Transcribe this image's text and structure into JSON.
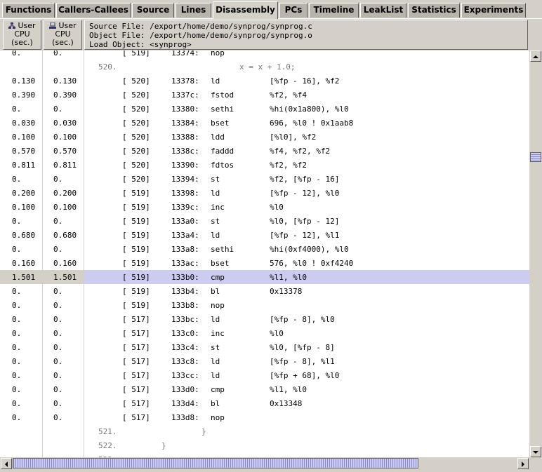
{
  "tabs": [
    {
      "label": "Functions",
      "active": false
    },
    {
      "label": "Callers-Callees",
      "active": false
    },
    {
      "label": "Source",
      "active": false
    },
    {
      "label": "Lines",
      "active": false
    },
    {
      "label": "Disassembly",
      "active": true
    },
    {
      "label": "PCs",
      "active": false
    },
    {
      "label": "Timeline",
      "active": false
    },
    {
      "label": "LeakList",
      "active": false
    },
    {
      "label": "Statistics",
      "active": false
    },
    {
      "label": "Experiments",
      "active": false
    }
  ],
  "header": {
    "col1": {
      "line1": "User",
      "line2": "CPU",
      "line3": "(sec.)"
    },
    "col2": {
      "line1": "User",
      "line2": "CPU",
      "line3": "(sec.)"
    },
    "source_file": "Source File: /export/home/demo/synprog/synprog.c",
    "object_file": "Object File: /export/home/demo/synprog/synprog.o",
    "load_object": "Load Object: <synprog>"
  },
  "rows": [
    {
      "kind": "asm",
      "c1": "0.",
      "c2": "0.",
      "line": "[ 519]",
      "addr": "13374:",
      "op": "nop",
      "args": ""
    },
    {
      "kind": "src",
      "num": "520.",
      "code": "x = x + 1.0;"
    },
    {
      "kind": "asm",
      "c1": "0.130",
      "c2": "0.130",
      "line": "[ 520]",
      "addr": "13378:",
      "op": "ld",
      "args": "[%fp - 16], %f2"
    },
    {
      "kind": "asm",
      "c1": "0.390",
      "c2": "0.390",
      "line": "[ 520]",
      "addr": "1337c:",
      "op": "fstod",
      "args": "%f2, %f4"
    },
    {
      "kind": "asm",
      "c1": "0.",
      "c2": "0.",
      "line": "[ 520]",
      "addr": "13380:",
      "op": "sethi",
      "args": "%hi(0x1a800), %l0"
    },
    {
      "kind": "asm",
      "c1": "0.030",
      "c2": "0.030",
      "line": "[ 520]",
      "addr": "13384:",
      "op": "bset",
      "args": "696, %l0 ! 0x1aab8"
    },
    {
      "kind": "asm",
      "c1": "0.100",
      "c2": "0.100",
      "line": "[ 520]",
      "addr": "13388:",
      "op": "ldd",
      "args": "[%l0], %f2"
    },
    {
      "kind": "asm",
      "c1": "0.570",
      "c2": "0.570",
      "line": "[ 520]",
      "addr": "1338c:",
      "op": "faddd",
      "args": "%f4, %f2, %f2"
    },
    {
      "kind": "asm",
      "c1": "0.811",
      "c2": "0.811",
      "line": "[ 520]",
      "addr": "13390:",
      "op": "fdtos",
      "args": "%f2, %f2"
    },
    {
      "kind": "asm",
      "c1": "0.",
      "c2": "0.",
      "line": "[ 520]",
      "addr": "13394:",
      "op": "st",
      "args": "%f2, [%fp - 16]"
    },
    {
      "kind": "asm",
      "c1": "0.200",
      "c2": "0.200",
      "line": "[ 519]",
      "addr": "13398:",
      "op": "ld",
      "args": "[%fp - 12], %l0"
    },
    {
      "kind": "asm",
      "c1": "0.100",
      "c2": "0.100",
      "line": "[ 519]",
      "addr": "1339c:",
      "op": "inc",
      "args": "%l0"
    },
    {
      "kind": "asm",
      "c1": "0.",
      "c2": "0.",
      "line": "[ 519]",
      "addr": "133a0:",
      "op": "st",
      "args": "%l0, [%fp - 12]"
    },
    {
      "kind": "asm",
      "c1": "0.680",
      "c2": "0.680",
      "line": "[ 519]",
      "addr": "133a4:",
      "op": "ld",
      "args": "[%fp - 12], %l1"
    },
    {
      "kind": "asm",
      "c1": "0.",
      "c2": "0.",
      "line": "[ 519]",
      "addr": "133a8:",
      "op": "sethi",
      "args": "%hi(0xf4000), %l0"
    },
    {
      "kind": "asm",
      "c1": "0.160",
      "c2": "0.160",
      "line": "[ 519]",
      "addr": "133ac:",
      "op": "bset",
      "args": "576, %l0 ! 0xf4240"
    },
    {
      "kind": "asm",
      "sel": true,
      "c1": "1.501",
      "c2": "1.501",
      "line": "[ 519]",
      "addr": "133b0:",
      "op": "cmp",
      "args": "%l1, %l0"
    },
    {
      "kind": "asm",
      "c1": "0.",
      "c2": "0.",
      "line": "[ 519]",
      "addr": "133b4:",
      "op": "bl",
      "args": "0x13378"
    },
    {
      "kind": "asm",
      "c1": "0.",
      "c2": "0.",
      "line": "[ 519]",
      "addr": "133b8:",
      "op": "nop",
      "args": ""
    },
    {
      "kind": "asm",
      "c1": "0.",
      "c2": "0.",
      "line": "[ 517]",
      "addr": "133bc:",
      "op": "ld",
      "args": "[%fp - 8], %l0"
    },
    {
      "kind": "asm",
      "c1": "0.",
      "c2": "0.",
      "line": "[ 517]",
      "addr": "133c0:",
      "op": "inc",
      "args": "%l0"
    },
    {
      "kind": "asm",
      "c1": "0.",
      "c2": "0.",
      "line": "[ 517]",
      "addr": "133c4:",
      "op": "st",
      "args": "%l0, [%fp - 8]"
    },
    {
      "kind": "asm",
      "c1": "0.",
      "c2": "0.",
      "line": "[ 517]",
      "addr": "133c8:",
      "op": "ld",
      "args": "[%fp - 8], %l1"
    },
    {
      "kind": "asm",
      "c1": "0.",
      "c2": "0.",
      "line": "[ 517]",
      "addr": "133cc:",
      "op": "ld",
      "args": "[%fp + 68], %l0"
    },
    {
      "kind": "asm",
      "c1": "0.",
      "c2": "0.",
      "line": "[ 517]",
      "addr": "133d0:",
      "op": "cmp",
      "args": "%l1, %l0"
    },
    {
      "kind": "asm",
      "c1": "0.",
      "c2": "0.",
      "line": "[ 517]",
      "addr": "133d4:",
      "op": "bl",
      "args": "0x13348"
    },
    {
      "kind": "asm",
      "c1": "0.",
      "c2": "0.",
      "line": "[ 517]",
      "addr": "133d8:",
      "op": "nop",
      "args": ""
    },
    {
      "kind": "src",
      "num": "521.",
      "code": "}"
    },
    {
      "kind": "src",
      "num": "522.",
      "code": "}"
    },
    {
      "kind": "src",
      "num": "523.",
      "code": ""
    }
  ],
  "scroll": {
    "vertical_position": 0.26,
    "horizontal_visible_fraction": 0.8
  }
}
